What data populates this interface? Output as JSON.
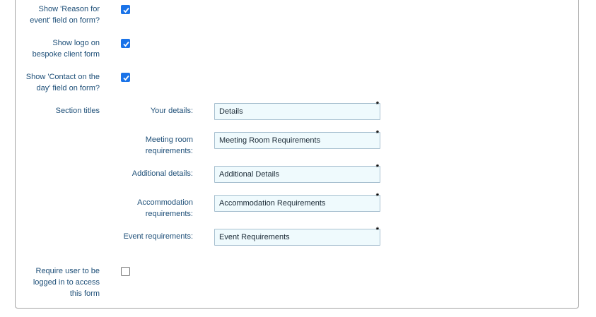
{
  "options": [
    {
      "label": "Show 'Reason for\nevent' field on form?",
      "checked": true
    },
    {
      "label": "Show logo on\nbespoke client form",
      "checked": true
    },
    {
      "label": "Show 'Contact on the\nday' field on form?",
      "checked": true
    },
    {
      "label": "Require user to be\nlogged in to access\nthis form",
      "checked": false
    }
  ],
  "section_titles": {
    "label": "Section titles",
    "fields": [
      {
        "label": "Your details:",
        "value": "Details"
      },
      {
        "label": "Meeting room\nrequirements:",
        "value": "Meeting Room Requirements"
      },
      {
        "label": "Additional details:",
        "value": "Additional Details"
      },
      {
        "label": "Accommodation\nrequirements:",
        "value": "Accommodation Requirements"
      },
      {
        "label": "Event requirements:",
        "value": "Event Requirements"
      }
    ],
    "required_marker": "*"
  },
  "colors": {
    "label": "#1e4f78",
    "checkbox_checked": "#1a73e8",
    "field_background": "#effafd"
  }
}
